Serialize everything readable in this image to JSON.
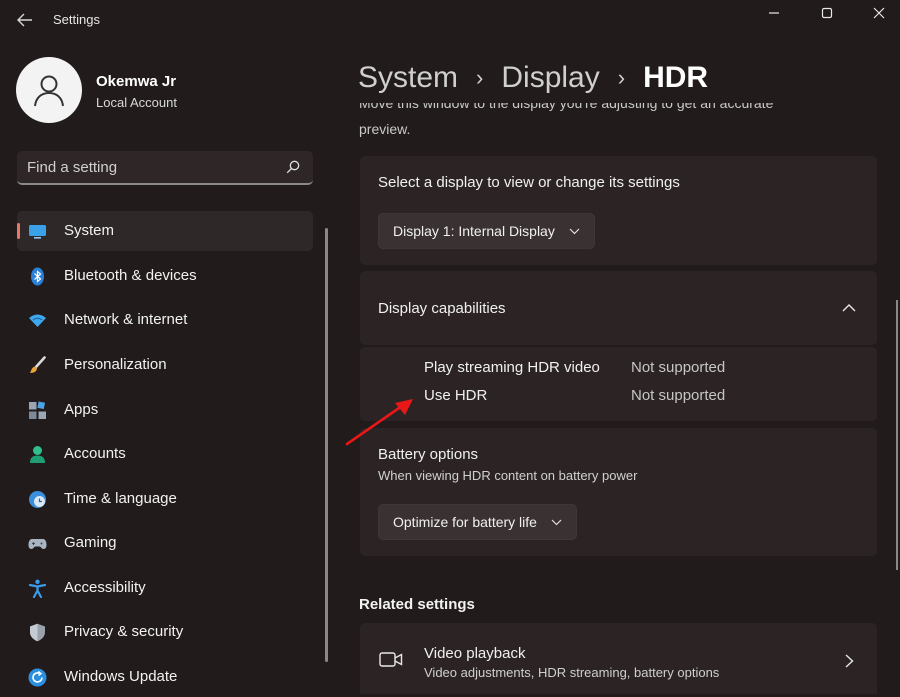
{
  "window": {
    "title": "Settings",
    "controls": [
      "minimize-icon",
      "maximize-icon",
      "close-icon"
    ]
  },
  "profile": {
    "name": "Okemwa Jr",
    "account_type": "Local Account"
  },
  "search": {
    "placeholder": "Find a setting"
  },
  "sidebar": {
    "items": [
      {
        "label": "System",
        "icon": "display-icon",
        "selected": true
      },
      {
        "label": "Bluetooth & devices",
        "icon": "bluetooth-icon"
      },
      {
        "label": "Network & internet",
        "icon": "wifi-icon"
      },
      {
        "label": "Personalization",
        "icon": "brush-icon"
      },
      {
        "label": "Apps",
        "icon": "apps-icon"
      },
      {
        "label": "Accounts",
        "icon": "person-icon"
      },
      {
        "label": "Time & language",
        "icon": "clock-globe-icon"
      },
      {
        "label": "Gaming",
        "icon": "gamepad-icon"
      },
      {
        "label": "Accessibility",
        "icon": "accessibility-icon"
      },
      {
        "label": "Privacy & security",
        "icon": "shield-icon"
      },
      {
        "label": "Windows Update",
        "icon": "update-icon"
      }
    ]
  },
  "breadcrumb": [
    "System",
    "Display",
    "HDR"
  ],
  "intro_text": {
    "line1": "Move this window to the display you're adjusting to get an accurate",
    "line2": "preview."
  },
  "display_select": {
    "title": "Select a display to view or change its settings",
    "dropdown_value": "Display 1: Internal Display"
  },
  "capabilities": {
    "title": "Display capabilities",
    "rows": [
      {
        "label": "Play streaming HDR video",
        "value": "Not supported"
      },
      {
        "label": "Use HDR",
        "value": "Not supported"
      }
    ]
  },
  "battery": {
    "title": "Battery options",
    "subtitle": "When viewing HDR content on battery power",
    "dropdown_value": "Optimize for battery life"
  },
  "related": {
    "title": "Related settings",
    "items": [
      {
        "label": "Video playback",
        "subtitle": "Video adjustments, HDR streaming, battery options",
        "icon": "video-icon"
      }
    ]
  },
  "colors": {
    "background": "#221b1b",
    "card": "#2c2424",
    "accent_indicator": "#e8756a",
    "annotation_arrow": "#e81818"
  }
}
